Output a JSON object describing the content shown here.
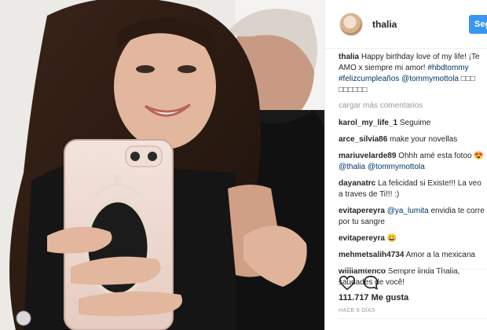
{
  "post": {
    "author": "thalia",
    "follow_label": "Seguir",
    "caption_text": " Happy birthday love of my life! ¡Te AMO x siempre mi amor! ",
    "caption_hashtags": [
      "#hbdtommy",
      "#felizcumpleaños"
    ],
    "caption_mention": "@tommymottola",
    "caption_emojis": "□□□ □□□□□□",
    "load_more": "cargar más comentarios",
    "likes": "111.717 Me gusta",
    "timestamp": "HACE 6 DÍAS"
  },
  "comments": [
    {
      "user": "karol_my_life_1",
      "text": " Seguime"
    },
    {
      "user": "arce_silvia86",
      "text": " make your novellas"
    },
    {
      "user": "mariuvelarde89",
      "text": " Ohhh amé esta fotoo 😍 ",
      "mention": "@thalia",
      "mention2": "@tommymottola"
    },
    {
      "user": "dayanatrc",
      "text": " La felicidad si Existe!!! La veo a traves de Ti!!! :)"
    },
    {
      "user": "evitapereyra",
      "mention": "@ya_lumita",
      "text": " envidia te corre por tu sangre"
    },
    {
      "user": "evitapereyra",
      "text": " 😀"
    },
    {
      "user": "mehmetsalih4734",
      "text": " Amor a la mexicana"
    },
    {
      "user": "williamtenco",
      "text": " Sempre linda Thalia, saudades de você!"
    }
  ],
  "icons": {
    "like": "heart-icon",
    "comment": "comment-icon"
  },
  "colors": {
    "accent": "#3897f0",
    "link": "#003569",
    "muted": "#999999",
    "text": "#262626"
  }
}
